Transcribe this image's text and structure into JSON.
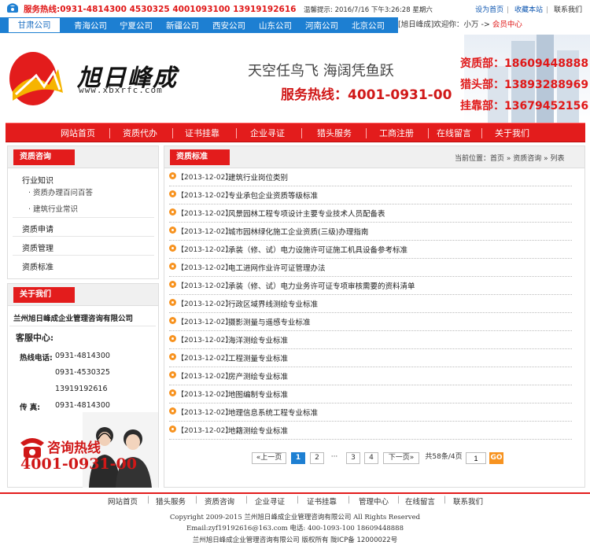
{
  "top": {
    "hotline": "服务热线:0931-4814300  4530325  4001093100  13919192616",
    "greeting": "温馨提示: 2016/7/16  下午3:26:28  星期六",
    "links": [
      "设为首页",
      "收藏本站",
      "联系我们"
    ]
  },
  "cities": [
    "甘肃公司",
    "青海公司",
    "宁夏公司",
    "新疆公司",
    "西安公司",
    "山东公司",
    "河南公司",
    "北京公司"
  ],
  "welcome": {
    "prefix": "[旭日峰成]欢迎你：",
    "user": "小万",
    "arrow": "->",
    "member": "会员中心"
  },
  "banner": {
    "logo_text": "旭日峰成",
    "logo_url": "www.xbxrfc.com",
    "slogan1": "天空任鸟飞  海阔凭鱼跃",
    "slogan2": "服务热线：4001-0931-00",
    "contacts": [
      "资质部：18609448888",
      "猎头部：13893288969",
      "挂靠部：13679452156"
    ]
  },
  "nav": [
    "网站首页",
    "资质代办",
    "证书挂靠",
    "企业寻证",
    "猎头服务",
    "工商注册",
    "在线留言",
    "关于我们"
  ],
  "sidebar": {
    "title": "资质咨询",
    "items": [
      "行业知识",
      "资质办理百问百答",
      "建筑行业常识",
      "资质申请",
      "资质管理",
      "资质标准"
    ],
    "about_title": "关于我们",
    "company": "兰州旭日峰成企业管理咨询有限公司",
    "service_title": "客服中心:",
    "phone_label": "热线电话:",
    "phones": [
      "0931-4814300",
      "0931-4530325",
      "13919192616"
    ],
    "fax_label": "传    真:",
    "fax": "0931-4814300",
    "hotline_label": "咨询热线",
    "hotline_number": "4001-0931-00"
  },
  "main": {
    "title": "资质标准",
    "breadcrumb": "当前位置：首页 » 资质咨询 » 列表",
    "list": [
      {
        "date": "【2013-12-02】",
        "title": "建筑行业岗位类别"
      },
      {
        "date": "【2013-12-02】",
        "title": "专业承包企业资质等级标准"
      },
      {
        "date": "【2013-12-02】",
        "title": "风景园林工程专项设计主要专业技术人员配备表"
      },
      {
        "date": "【2013-12-02】",
        "title": "城市园林绿化施工企业资质(三级)办理指南"
      },
      {
        "date": "【2013-12-02】",
        "title": "承装（修、试）电力设施许可证施工机具设备参考标准"
      },
      {
        "date": "【2013-12-02】",
        "title": "电工进网作业许可证管理办法"
      },
      {
        "date": "【2013-12-02】",
        "title": "承装（修、试）电力业务许可证专项审核需要的资料清单"
      },
      {
        "date": "【2013-12-02】",
        "title": "行政区域界线测绘专业标准"
      },
      {
        "date": "【2013-12-02】",
        "title": "摄影测量与遥感专业标准"
      },
      {
        "date": "【2013-12-02】",
        "title": "海洋测绘专业标准"
      },
      {
        "date": "【2013-12-02】",
        "title": "工程测量专业标准"
      },
      {
        "date": "【2013-12-02】",
        "title": "房产测绘专业标准"
      },
      {
        "date": "【2013-12-02】",
        "title": "地图编制专业标准"
      },
      {
        "date": "【2013-12-02】",
        "title": "地理信息系统工程专业标准"
      },
      {
        "date": "【2013-12-02】",
        "title": "地籍测绘专业标准"
      }
    ],
    "pager": {
      "prev": "«上一页",
      "pages": [
        "1",
        "2",
        "···",
        "3",
        "4"
      ],
      "next": "下一页»",
      "info": "共58条/4页",
      "input": "1",
      "go": "GO"
    }
  },
  "footer": {
    "nav": [
      "网站首页",
      "猎头服务",
      "资质咨询",
      "企业寻证",
      "证书挂靠",
      "管理中心",
      "在线留言",
      "联系我们"
    ],
    "copyright": "Copyright 2009-2015 兰州旭日峰成企业管理咨询有限公司 All Rights Reserved",
    "email": "Email:zyf19192616@163.com  电话: 400-1093-100 18609448888",
    "owner": "兰州旭日峰成企业管理咨询有限公司 版权所有  陇ICP备 12000022号"
  },
  "colors": {
    "red": "#e31c1c",
    "blue": "#1d7fd2",
    "orange": "#f79320"
  },
  "icons": [
    "phone-icon",
    "sun-logo-icon",
    "bullet-icon",
    "telephone-hotline-icon"
  ]
}
